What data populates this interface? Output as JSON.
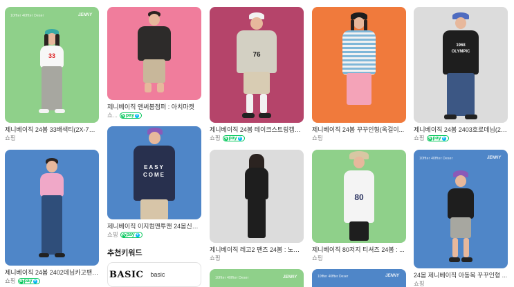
{
  "watermark": {
    "left": "10ffter 40ffter Deser",
    "right": "JENNY"
  },
  "columns": [
    {
      "cards": [
        {
          "title": "제니베이직 24봄 33배색티(2X-7X) : 제니...",
          "source": "쇼핑",
          "npay": false
        },
        {
          "title": "제니베이직 24봄 2402데님카고팬즈(2X-7X)...",
          "source": "쇼핑",
          "npay": true
        }
      ]
    },
    {
      "cards": [
        {
          "title": "제니베이직 앤써봄점퍼 : 아치마켓",
          "source": "쇼...",
          "npay": true
        },
        {
          "title": "제니베이직 이지컴맨투맨 24봄신상 ...",
          "source": "쇼핑",
          "npay": true
        }
      ],
      "keywords": {
        "heading": "추천키워드",
        "items": [
          {
            "logo": "BASIC",
            "label": "basic"
          }
        ]
      }
    },
    {
      "cards": [
        {
          "title": "제니베이직 24봄 테이크스트링캡모자...",
          "source": "쇼핑",
          "npay": true
        },
        {
          "title": "제니베이직 레고2 팬즈 24봄 : 노랑...",
          "source": "쇼핑",
          "npay": false
        }
      ]
    },
    {
      "cards": [
        {
          "title": "제니베이직 24봄 꾸꾸인형(옥걸이...",
          "source": "쇼핑",
          "npay": false
        },
        {
          "title": "제니베이직 80저지 티셔즈 24봄 : ...",
          "source": "쇼핑",
          "npay": false
        }
      ]
    },
    {
      "cards": [
        {
          "title": "제니베이직 24봄 2403호로데님(2X-...",
          "source": "쇼핑",
          "npay": true
        },
        {
          "title": "24봄 제니베이직 아동복 꾸꾸인형 ...",
          "source": "쇼핑",
          "npay": false
        }
      ]
    }
  ],
  "shirt_texts": {
    "c1a": "33",
    "c2b": "EASY COME",
    "c3a": "76",
    "c4b": "80",
    "c5a": "1968 OLYMPIC"
  },
  "npay_label": "pay",
  "colors": {
    "green_bg": "#8fd08a",
    "pink_bg": "#f07d9c",
    "berry_bg": "#b5446a",
    "orange_bg": "#f07a3c",
    "light_grey_bg": "#dcdcdc",
    "blue_bg": "#4f86c8",
    "npay_green": "#03c75a"
  }
}
